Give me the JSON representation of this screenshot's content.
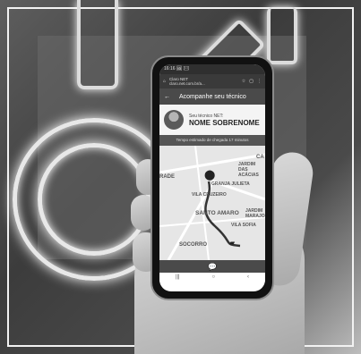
{
  "status_time": "16:16 🖼 ✉",
  "browser": {
    "title": "Claro NET",
    "url": "claro.net.com.br/a..."
  },
  "app": {
    "title": "Acompanhe seu técnico",
    "technician_label": "Seu técnico NET:",
    "technician_name": "NOME SOBRENOME",
    "eta_text": "Tempo estimado de chegada 17 minutos"
  },
  "map_labels": {
    "jardim_acacias": "JARDIM DAS ACÁCIAS",
    "granja_julieta": "GRANJA JULIETA",
    "vila_cruzeiro": "VILA CRUZEIRO",
    "santo_amaro": "SANTO AMARO",
    "jardim_marajoara": "JARDIM MARAJOARA",
    "vila_sofia": "VILA SOFIA",
    "socorro": "SOCORRO",
    "rade": "RADE",
    "ca": "CA"
  }
}
